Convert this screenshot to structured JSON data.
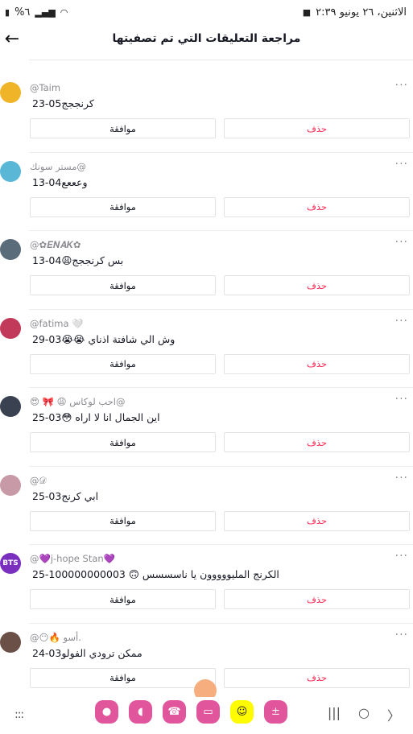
{
  "status_bar": {
    "datetime": "الاثنين، ٢٦ يونيو ٢:٣٩",
    "battery": "%٦",
    "record_icon": "video-record-icon",
    "signal_icon": "signal-icon",
    "wifi_icon": "wifi-icon"
  },
  "header": {
    "title": "مراجعة التعليقات التي تم تصفيتها",
    "back_icon": "arrow-left-icon"
  },
  "buttons": {
    "approve": "موافقة",
    "delete": "حذف"
  },
  "more_label": "···",
  "comments": [
    {
      "username": "@Taim",
      "text": "كرنججج",
      "date": "05-23",
      "avatar_color": "#f0b429"
    },
    {
      "username": "مستر سونك@",
      "text": "وعععع",
      "date": "04-13",
      "avatar_color": "#5bb7d6"
    },
    {
      "username": "@✿𝑬𝑵𝑨𝑲✿",
      "text": "بس كرنججج😩",
      "date": "04-13",
      "avatar_color": "#5a6b7a"
    },
    {
      "username": "@fatima 🤍",
      "text": "وش الي شافتة اذناي 😭😭",
      "date": "03-29",
      "avatar_color": "#c23a5a"
    },
    {
      "username": "😍 🎀 😩 احب لوكاس@",
      "text": "اين الجمال انا لا اراه 😳",
      "date": "03-25",
      "avatar_color": "#3a4150"
    },
    {
      "username": "@𝒟",
      "text": "ابي كرنج",
      "date": "03-25",
      "avatar_color": "#c89aa8"
    },
    {
      "username": "@💜j-hope Stan💜",
      "text": "الكرنج المليووووون يا ناسسسس 🙃 1000000000",
      "date": "03-25",
      "avatar_color": "#7b2fbe",
      "avatar_text": "BTS"
    },
    {
      "username": "@😶🔥 أسو.",
      "text": "ممكن ترودي الفولو",
      "date": "03-24",
      "avatar_color": "#6b5048"
    }
  ],
  "colors": {
    "delete_red": "#fe2c55",
    "muted": "#8a8b91"
  },
  "dock_apps": [
    {
      "name": "contacts-app-icon",
      "glyph": "●",
      "color": "#e0559b"
    },
    {
      "name": "messages-app-icon",
      "glyph": "◖",
      "color": "#e0559b"
    },
    {
      "name": "phone-app-icon",
      "glyph": "☎",
      "color": "#e0559b"
    },
    {
      "name": "files-app-icon",
      "glyph": "▭",
      "color": "#e0559b"
    },
    {
      "name": "snapchat-app-icon",
      "glyph": "☺",
      "color": "#fffc00"
    },
    {
      "name": "calculator-app-icon",
      "glyph": "±",
      "color": "#e0559b"
    }
  ],
  "nav": {
    "apps": ":::",
    "recents": "|||",
    "home": "○",
    "back": "〉"
  }
}
